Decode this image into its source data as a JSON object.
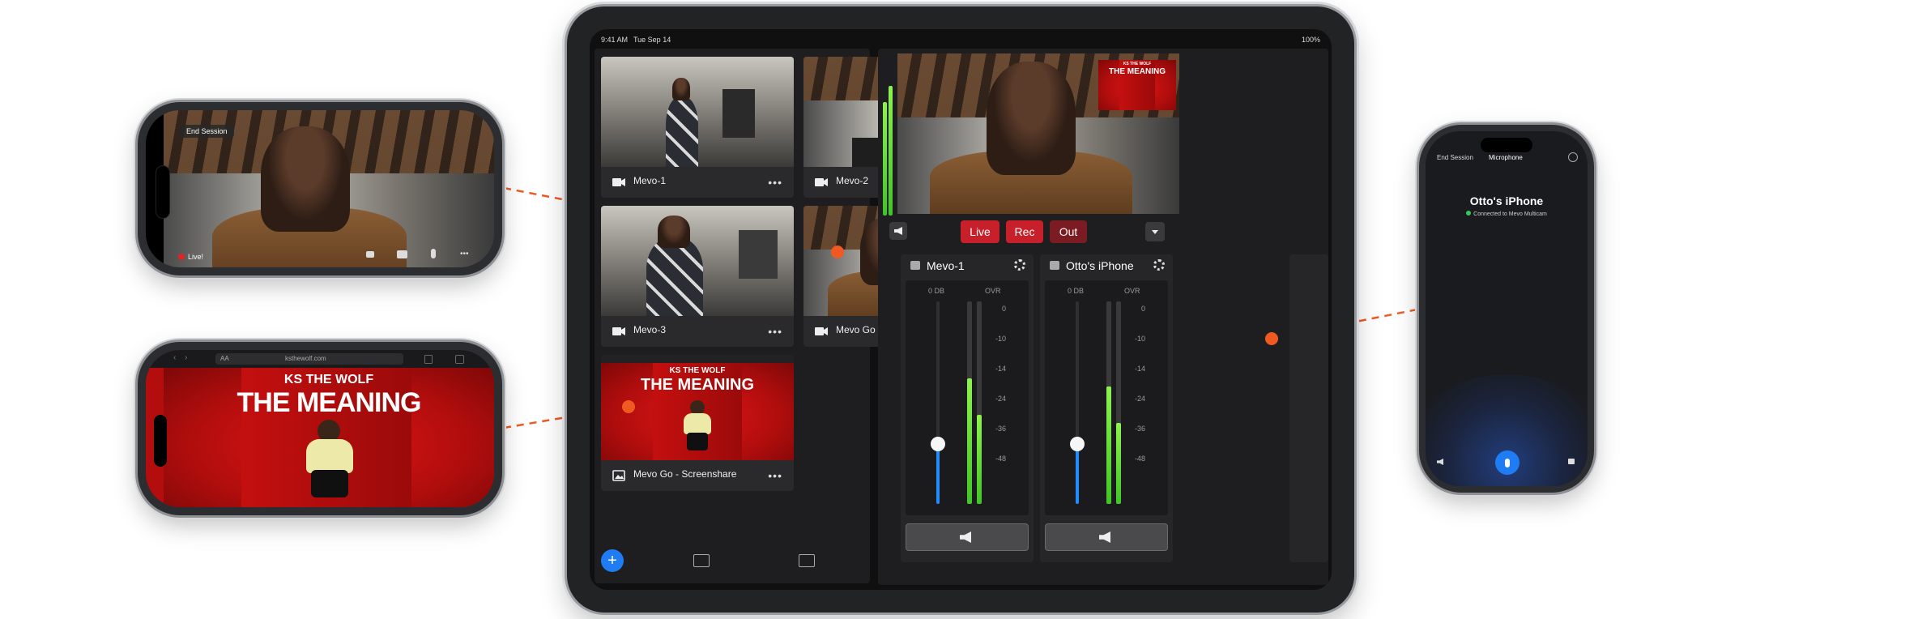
{
  "colors": {
    "accent_red": "#c8202a",
    "connector_orange": "#f05a22",
    "meter_green": "#5fdc2e",
    "fader_blue": "#1f8cff"
  },
  "ipad": {
    "status_time": "9:41 AM",
    "status_date": "Tue Sep 14",
    "status_battery": "100%",
    "sources": [
      {
        "label": "Mevo-1",
        "icon": "video-camera-icon"
      },
      {
        "label": "Mevo-2",
        "icon": "video-camera-icon"
      },
      {
        "label": "Mevo-3",
        "icon": "video-camera-icon"
      },
      {
        "label": "Mevo Go - Camera",
        "icon": "video-camera-icon"
      },
      {
        "label": "Mevo Go - Screenshare",
        "icon": "image-icon"
      }
    ],
    "more_glyph": "•••",
    "program": {
      "live_label": "Live",
      "rec_label": "Rec",
      "out_label": "Out"
    },
    "pip_art": {
      "line1": "KS THE WOLF",
      "line2": "THE MEANING"
    },
    "mixer": {
      "db_label": "0 DB",
      "ovr_label": "OVR",
      "ticks": [
        "0",
        "-10",
        "-14",
        "-24",
        "-36",
        "-48"
      ],
      "channels": [
        {
          "name": "Mevo-1",
          "icon": "video-camera-icon",
          "level": 0.62
        },
        {
          "name": "Otto's iPhone",
          "icon": "microphone-icon",
          "level": 0.58
        }
      ]
    },
    "toolbar_more": "•••"
  },
  "phone_camera": {
    "end_session": "End Session",
    "live_badge": "Live!"
  },
  "phone_browser": {
    "url": "ksthewolf.com",
    "text_size": "AA",
    "art_line1": "KS THE WOLF",
    "art_line2": "THE MEANING"
  },
  "phone_mic": {
    "end_session": "End Session",
    "tab": "Microphone",
    "device_name": "Otto's iPhone",
    "status": "Connected to Mevo Multicam"
  }
}
